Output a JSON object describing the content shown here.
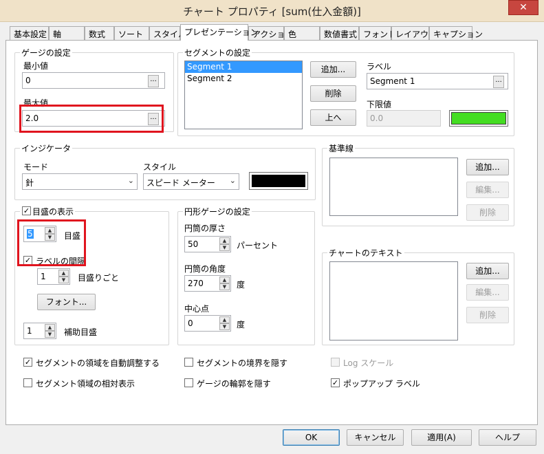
{
  "window": {
    "title": "チャート プロパティ [sum(仕入金額)]",
    "close_glyph": "✕"
  },
  "tabs": [
    "基本設定",
    "軸",
    "数式",
    "ソート",
    "スタイル",
    "プレゼンテーション",
    "アクション",
    "色",
    "数値書式",
    "フォント",
    "レイアウト",
    "キャプション"
  ],
  "active_tab": "プレゼンテーション",
  "gauge": {
    "legend": "ゲージの設定",
    "min_label": "最小値",
    "min_value": "0",
    "max_label": "最大値",
    "max_value": "2.0",
    "browse": "..."
  },
  "segments": {
    "legend": "セグメントの設定",
    "items": [
      "Segment 1",
      "Segment 2"
    ],
    "selected": "Segment 1",
    "add": "追加...",
    "delete": "削除",
    "up": "上へ",
    "label_caption": "ラベル",
    "label_value": "Segment 1",
    "lower_caption": "下限値",
    "lower_value": "0.0",
    "color": "#44dd22"
  },
  "indicator": {
    "legend": "インジケータ",
    "mode_label": "モード",
    "mode_value": "針",
    "style_label": "スタイル",
    "style_value": "スピード メーター",
    "color": "#000000"
  },
  "baseline": {
    "legend": "基準線",
    "add": "追加...",
    "edit": "編集...",
    "delete": "削除"
  },
  "scale": {
    "show_label": "目盛の表示",
    "show_checked": true,
    "ticks_value": "5",
    "ticks_label": "目盛",
    "label_interval_label": "ラベルの間隔",
    "label_interval_checked": true,
    "interval_value": "1",
    "interval_suffix": "目盛りごと",
    "font_button": "フォント...",
    "minor_value": "1",
    "minor_label": "補助目盛"
  },
  "circular": {
    "legend": "円形ゲージの設定",
    "thickness_label": "円筒の厚さ",
    "thickness_value": "50",
    "thickness_unit": "パーセント",
    "angle_label": "円筒の角度",
    "angle_value": "270",
    "angle_unit": "度",
    "center_label": "中心点",
    "center_value": "0",
    "center_unit": "度"
  },
  "chart_text": {
    "legend": "チャートのテキスト",
    "add": "追加...",
    "edit": "編集...",
    "delete": "削除"
  },
  "options": {
    "autofit_label": "セグメントの領域を自動調整する",
    "autofit_checked": true,
    "relative_label": "セグメント領域の相対表示",
    "relative_checked": false,
    "hide_segment_border_label": "セグメントの境界を隠す",
    "hide_segment_border_checked": false,
    "hide_gauge_outline_label": "ゲージの輪郭を隠す",
    "hide_gauge_outline_checked": false,
    "log_scale_label": "Log スケール",
    "log_scale_checked": false,
    "popup_label": "ポップアップ ラベル",
    "popup_checked": true
  },
  "footer": {
    "ok": "OK",
    "cancel": "キャンセル",
    "apply": "適用(A)",
    "help": "ヘルプ"
  },
  "glyphs": {
    "check": "✓",
    "combo_arrow": "⌄",
    "spin_up": "▲",
    "spin_down": "▼"
  }
}
